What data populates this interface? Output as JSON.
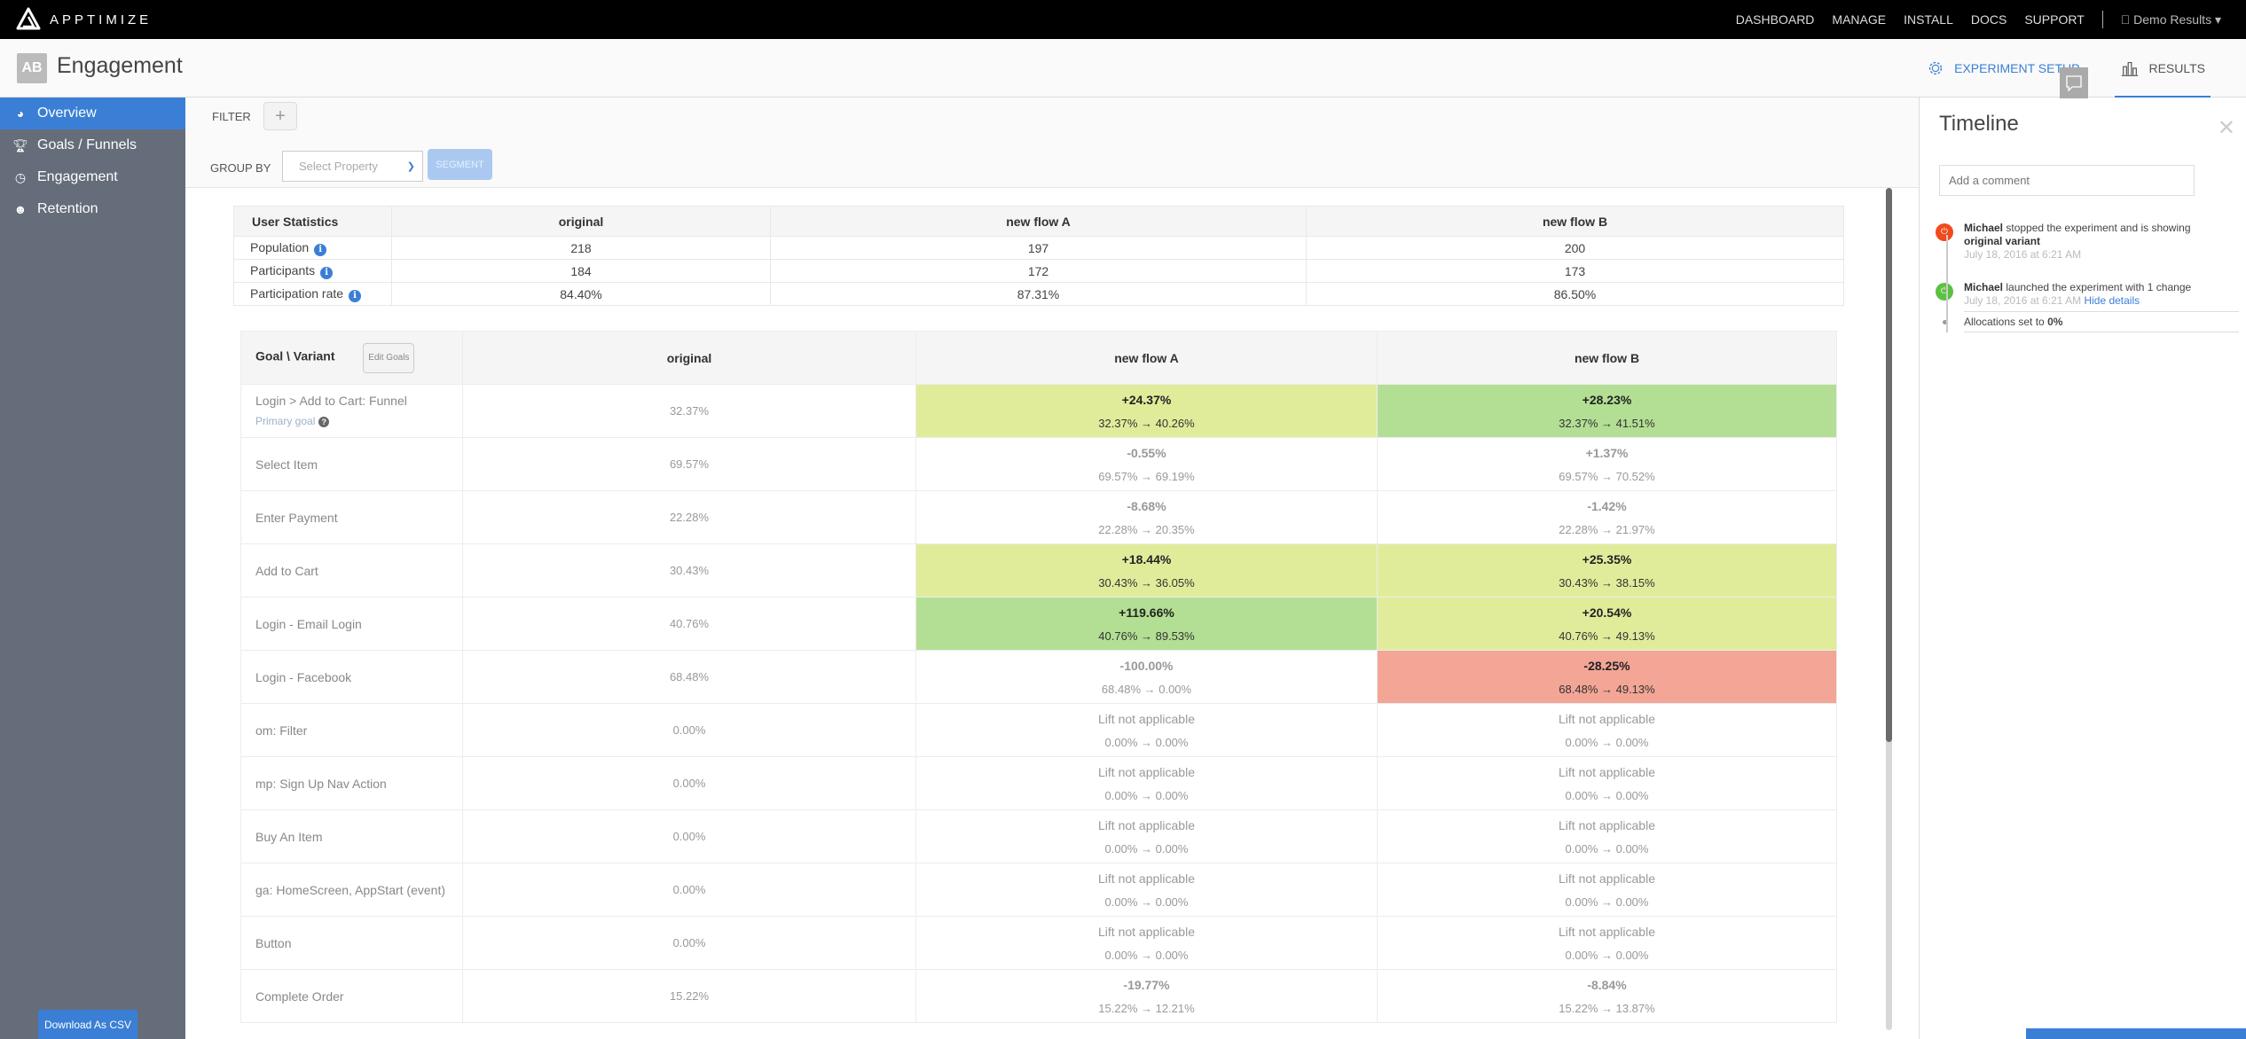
{
  "app": {
    "brand": "APPTIMIZE"
  },
  "topnav": {
    "items": [
      "DASHBOARD",
      "MANAGE",
      "INSTALL",
      "DOCS",
      "SUPPORT"
    ],
    "account": "Demo Results"
  },
  "header": {
    "badge": "AB",
    "title": "Engagement",
    "tabs": [
      {
        "label": "EXPERIMENT SETUP",
        "icon": "gear-icon",
        "active": false
      },
      {
        "label": "RESULTS",
        "icon": "bar-chart-icon",
        "active": true
      }
    ]
  },
  "sidebar": {
    "items": [
      {
        "label": "Overview",
        "icon": "dashboard-icon",
        "active": true
      },
      {
        "label": "Goals / Funnels",
        "icon": "trophy-icon",
        "active": false
      },
      {
        "label": "Engagement",
        "icon": "clock-icon",
        "active": false
      },
      {
        "label": "Retention",
        "icon": "users-icon",
        "active": false
      }
    ],
    "download_label": "Download As CSV"
  },
  "filters": {
    "filter_label": "FILTER",
    "add_label": "+",
    "group_by_label": "GROUP BY",
    "select_placeholder": "Select Property",
    "segment_label": "SEGMENT"
  },
  "user_stats": {
    "header": "User Statistics",
    "variants": [
      "original",
      "new flow A",
      "new flow B"
    ],
    "rows": [
      {
        "label": "Population",
        "values": [
          "218",
          "197",
          "200"
        ]
      },
      {
        "label": "Participants",
        "values": [
          "184",
          "172",
          "173"
        ]
      },
      {
        "label": "Participation rate",
        "values": [
          "84.40%",
          "87.31%",
          "86.50%"
        ]
      }
    ]
  },
  "goals": {
    "header": "Goal \\ Variant",
    "edit_label": "Edit Goals",
    "variants": [
      "original",
      "new flow A",
      "new flow B"
    ],
    "primary_goal_label": "Primary goal",
    "rows": [
      {
        "name": "Login > Add to Cart: Funnel",
        "primary": true,
        "original": "32.37%",
        "a": {
          "lift": "+24.37%",
          "range": "32.37% → 40.26%",
          "tone": "light"
        },
        "b": {
          "lift": "+28.23%",
          "range": "32.37% → 41.51%",
          "tone": "strong"
        }
      },
      {
        "name": "Select Item",
        "original": "69.57%",
        "a": {
          "lift": "-0.55%",
          "range": "69.57% → 69.19%",
          "tone": "none"
        },
        "b": {
          "lift": "+1.37%",
          "range": "69.57% → 70.52%",
          "tone": "none"
        }
      },
      {
        "name": "Enter Payment",
        "original": "22.28%",
        "a": {
          "lift": "-8.68%",
          "range": "22.28% → 20.35%",
          "tone": "none"
        },
        "b": {
          "lift": "-1.42%",
          "range": "22.28% → 21.97%",
          "tone": "none"
        }
      },
      {
        "name": "Add to Cart",
        "original": "30.43%",
        "a": {
          "lift": "+18.44%",
          "range": "30.43% → 36.05%",
          "tone": "light"
        },
        "b": {
          "lift": "+25.35%",
          "range": "30.43% → 38.15%",
          "tone": "light"
        }
      },
      {
        "name": "Login - Email Login",
        "original": "40.76%",
        "a": {
          "lift": "+119.66%",
          "range": "40.76% → 89.53%",
          "tone": "strong"
        },
        "b": {
          "lift": "+20.54%",
          "range": "40.76% → 49.13%",
          "tone": "light"
        }
      },
      {
        "name": "Login - Facebook",
        "original": "68.48%",
        "a": {
          "lift": "-100.00%",
          "range": "68.48% → 0.00%",
          "tone": "none"
        },
        "b": {
          "lift": "-28.25%",
          "range": "68.48% → 49.13%",
          "tone": "neg"
        }
      },
      {
        "name": "om: Filter",
        "original": "0.00%",
        "a": {
          "lift": "Lift not applicable",
          "range": "0.00% → 0.00%",
          "tone": "na"
        },
        "b": {
          "lift": "Lift not applicable",
          "range": "0.00% → 0.00%",
          "tone": "na"
        }
      },
      {
        "name": "mp: Sign Up Nav Action",
        "original": "0.00%",
        "a": {
          "lift": "Lift not applicable",
          "range": "0.00% → 0.00%",
          "tone": "na"
        },
        "b": {
          "lift": "Lift not applicable",
          "range": "0.00% → 0.00%",
          "tone": "na"
        }
      },
      {
        "name": "Buy An Item",
        "original": "0.00%",
        "a": {
          "lift": "Lift not applicable",
          "range": "0.00% → 0.00%",
          "tone": "na"
        },
        "b": {
          "lift": "Lift not applicable",
          "range": "0.00% → 0.00%",
          "tone": "na"
        }
      },
      {
        "name": "ga: HomeScreen, AppStart (event)",
        "original": "0.00%",
        "a": {
          "lift": "Lift not applicable",
          "range": "0.00% → 0.00%",
          "tone": "na"
        },
        "b": {
          "lift": "Lift not applicable",
          "range": "0.00% → 0.00%",
          "tone": "na"
        }
      },
      {
        "name": "Button",
        "original": "0.00%",
        "a": {
          "lift": "Lift not applicable",
          "range": "0.00% → 0.00%",
          "tone": "na"
        },
        "b": {
          "lift": "Lift not applicable",
          "range": "0.00% → 0.00%",
          "tone": "na"
        }
      },
      {
        "name": "Complete Order",
        "original": "15.22%",
        "a": {
          "lift": "-19.77%",
          "range": "15.22% → 12.21%",
          "tone": "none"
        },
        "b": {
          "lift": "-8.84%",
          "range": "15.22% → 13.87%",
          "tone": "none"
        }
      }
    ]
  },
  "timeline": {
    "title": "Timeline",
    "comment_placeholder": "Add a comment",
    "events": [
      {
        "user": "Michael",
        "text": "stopped the experiment and is showing",
        "bold_tail": "original variant",
        "date": "July 18, 2016 at 6:21 AM",
        "color": "#f04a1c"
      },
      {
        "user": "Michael",
        "text": "launched the experiment with 1 change",
        "date": "July 18, 2016 at 6:21 AM",
        "link": "Hide details",
        "color": "#5cc143"
      }
    ],
    "detail": {
      "text": "Allocations set to",
      "value": "0%"
    }
  }
}
